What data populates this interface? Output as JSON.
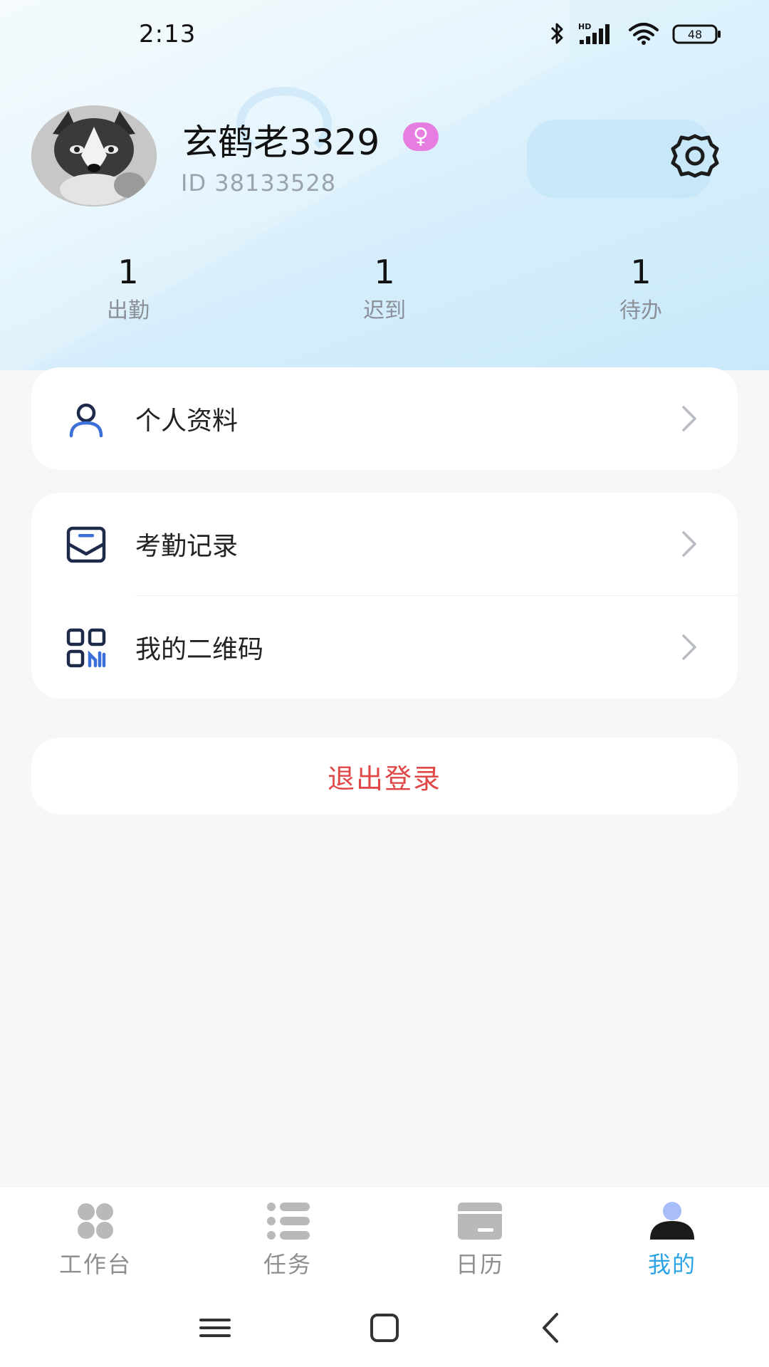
{
  "status_bar": {
    "time": "2:13",
    "battery": "48",
    "icons": [
      "bluetooth-icon",
      "hd-signal-icon",
      "wifi-icon",
      "battery-icon"
    ]
  },
  "profile": {
    "username": "玄鹤老3329",
    "gender_symbol": "♀",
    "user_id": "ID 38133528",
    "settings_icon": "gear-icon"
  },
  "stats": [
    {
      "value": "1",
      "label": "出勤"
    },
    {
      "value": "1",
      "label": "迟到"
    },
    {
      "value": "1",
      "label": "待办"
    }
  ],
  "menu": {
    "profile_info": {
      "label": "个人资料",
      "icon": "user-icon"
    },
    "attendance_records": {
      "label": "考勤记录",
      "icon": "mail-tray-icon"
    },
    "my_qr_code": {
      "label": "我的二维码",
      "icon": "qr-code-icon"
    }
  },
  "logout_label": "退出登录",
  "tabs": [
    {
      "label": "工作台",
      "icon": "grid-icon",
      "active": false
    },
    {
      "label": "任务",
      "icon": "list-icon",
      "active": false
    },
    {
      "label": "日历",
      "icon": "calendar-icon",
      "active": false
    },
    {
      "label": "我的",
      "icon": "person-icon",
      "active": true
    }
  ],
  "colors": {
    "accent": "#2aa4e6",
    "logout": "#e04848",
    "gender_badge": "#e57ee0",
    "icon_blue": "#3d6fd9"
  }
}
